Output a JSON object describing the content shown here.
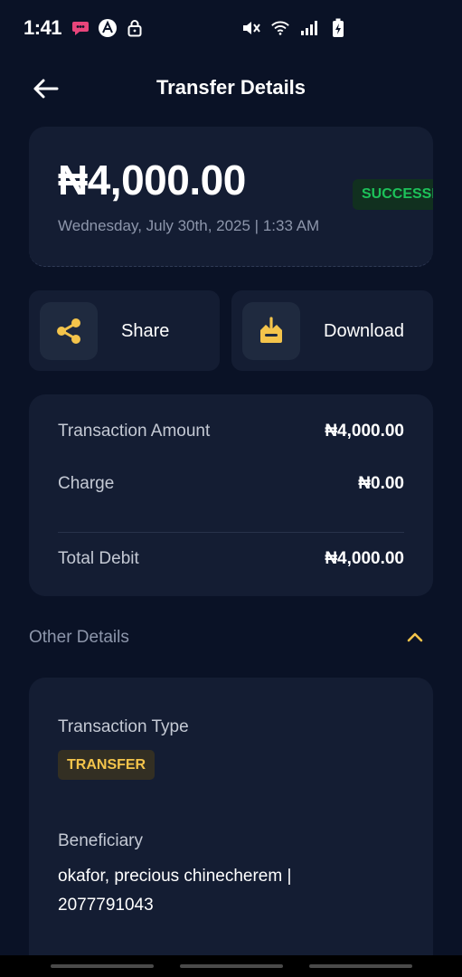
{
  "status_bar": {
    "time": "1:41",
    "left_icons": [
      "messaging-icon",
      "app-icon",
      "lock-icon"
    ],
    "right_icons": [
      "mute-icon",
      "wifi-icon",
      "signal-icon",
      "battery-charging-icon"
    ]
  },
  "header": {
    "title": "Transfer Details"
  },
  "hero": {
    "amount": "₦4,000.00",
    "date": "Wednesday, July 30th, 2025 | 1:33 AM",
    "status": "SUCCESSFUL"
  },
  "actions": {
    "share_label": "Share",
    "download_label": "Download"
  },
  "summary": {
    "rows": [
      {
        "label": "Transaction Amount",
        "value": "₦4,000.00"
      },
      {
        "label": "Charge",
        "value": "₦0.00"
      },
      {
        "label": "Total Debit",
        "value": "₦4,000.00"
      }
    ]
  },
  "other_details": {
    "title": "Other Details",
    "transaction_type_label": "Transaction Type",
    "transaction_type_value": "TRANSFER",
    "beneficiary_label": "Beneficiary",
    "beneficiary_value": "okafor, precious chinecherem | 2077791043"
  },
  "colors": {
    "background": "#0a1226",
    "card": "#141d33",
    "accent": "#f4c44b",
    "success": "#1dc25a"
  }
}
